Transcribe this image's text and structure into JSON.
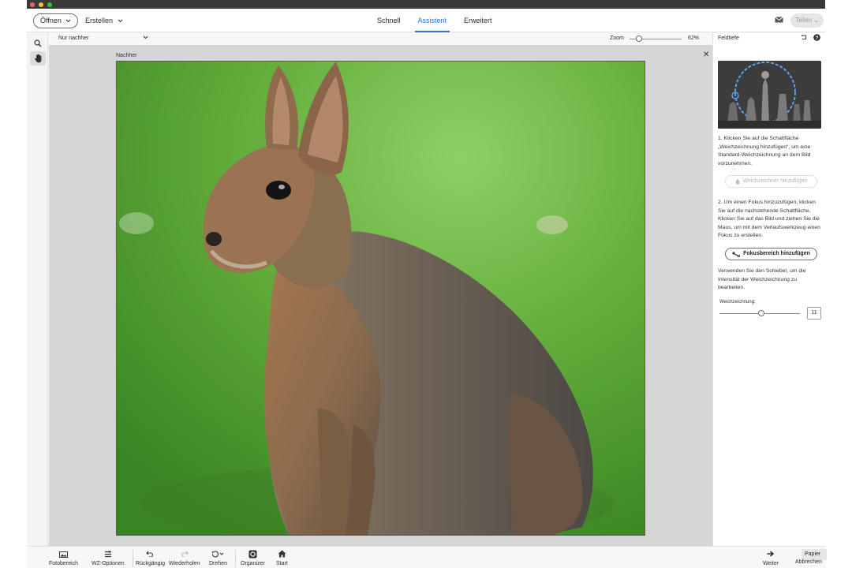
{
  "topbar": {
    "open_label": "Öffnen",
    "create_label": "Erstellen",
    "modes": [
      "Schnell",
      "Assistent",
      "Erweitert"
    ],
    "active_mode": "Assistent",
    "share_label": "Teilen"
  },
  "options": {
    "view_select": "Nur nachher",
    "zoom_label": "Zoom",
    "zoom_value": "62%",
    "zoom_level": 0.18
  },
  "canvas": {
    "view_label": "Nachher"
  },
  "panel": {
    "title": "Feldtiefe",
    "step1": "1. Klicken Sie auf die Schaltfläche „Weichzeichnung hinzufügen“, um eine Standard-Weichzeichnung an dem Bild vorzunehmen.",
    "add_blur_button": "Weichzeichner hinzufügen",
    "step2": "2. Um einen Fokus hinzuzufügen, klicken Sie auf die nachstehende Schaltfläche. Klicken Sie auf das Bild und ziehen Sie die Maus, um mit dem Verlaufswerkzeug einen Fokus zu erstellen.",
    "add_focus_button": "Fokusbereich hinzufügen",
    "slider_hint": "Verwenden Sie den Schieber, um die Intensität der Weichzeichnung zu bearbeiten.",
    "blur_label": "Weichzeichnung:",
    "blur_value": "11",
    "blur_level": 0.52
  },
  "bottombar": {
    "items": [
      "Fotobereich",
      "WZ-Optionen",
      "Rückgängig",
      "Wiederholen",
      "Drehen",
      "Organizer",
      "Start"
    ],
    "next_label": "Weiter",
    "cancel_label": "Abbrechen",
    "paper_label": "Papier"
  },
  "colors": {
    "accent": "#2a73d9",
    "canvas_bg": "#d6d6d6",
    "title_bar": "#3a3a3a"
  }
}
